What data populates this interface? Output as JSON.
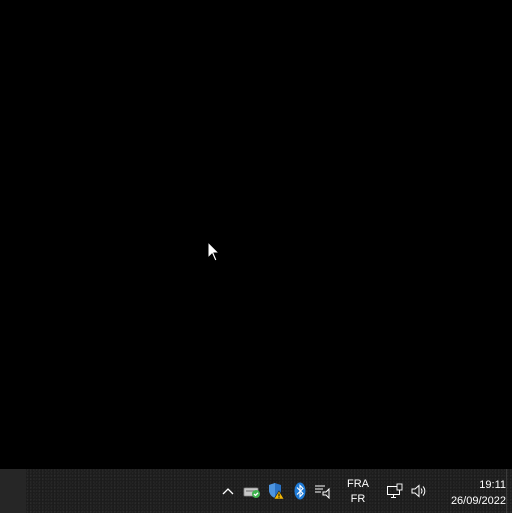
{
  "taskbar": {
    "language": {
      "line1": "FRA",
      "line2": "FR"
    },
    "clock": {
      "time": "19:11",
      "date": "26/09/2022"
    },
    "tray_icons": [
      "chevron-up-icon",
      "storage-check-icon",
      "windows-security-warning-icon",
      "bluetooth-icon",
      "action-center-icon",
      "network-icon",
      "volume-icon"
    ]
  },
  "colors": {
    "desktop": "#000000",
    "taskbar": "#1c1c1c",
    "bluetooth": "#1e7ad6",
    "security_shield": "#2a72c4",
    "warning": "#f2b705",
    "check": "#3fb34f"
  }
}
